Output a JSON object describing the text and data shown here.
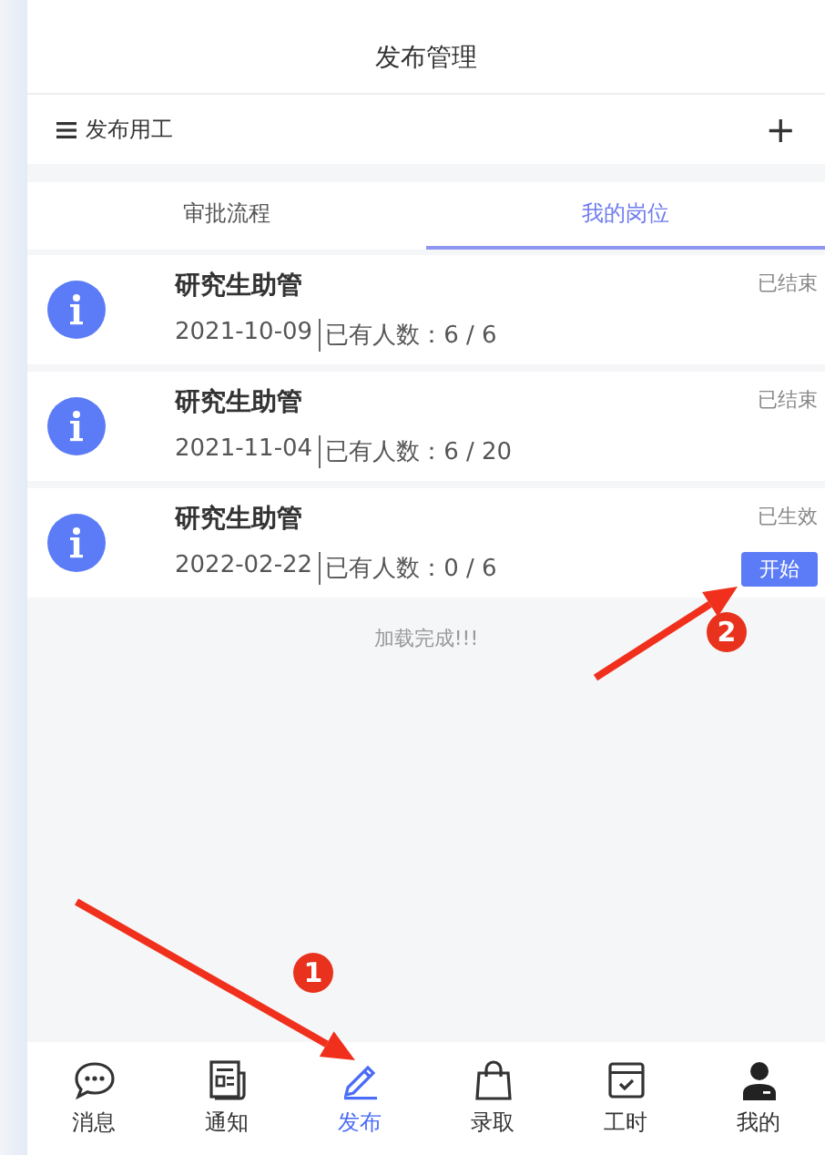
{
  "header": {
    "title": "发布管理"
  },
  "toolbar": {
    "menu_label": "发布用工",
    "add": "+"
  },
  "tabs": [
    {
      "label": "审批流程",
      "selected": false
    },
    {
      "label": "我的岗位",
      "selected": true
    }
  ],
  "jobs": [
    {
      "title": "研究生助管",
      "date": "2021-10-09",
      "headcount": "已有人数：6 / 6",
      "status": "已结束"
    },
    {
      "title": "研究生助管",
      "date": "2021-11-04",
      "headcount": "已有人数：6 / 20",
      "status": "已结束"
    },
    {
      "title": "研究生助管",
      "date": "2022-02-22",
      "headcount": "已有人数：0 / 6",
      "status": "已生效",
      "action": "开始"
    }
  ],
  "footer_note": "加载完成!!!",
  "bottom_nav": [
    {
      "label": "消息",
      "selected": false
    },
    {
      "label": "通知",
      "selected": false
    },
    {
      "label": "发布",
      "selected": true
    },
    {
      "label": "录取",
      "selected": false
    },
    {
      "label": "工时",
      "selected": false
    },
    {
      "label": "我的",
      "selected": false
    }
  ],
  "annotations": [
    {
      "label": "1"
    },
    {
      "label": "2"
    }
  ]
}
